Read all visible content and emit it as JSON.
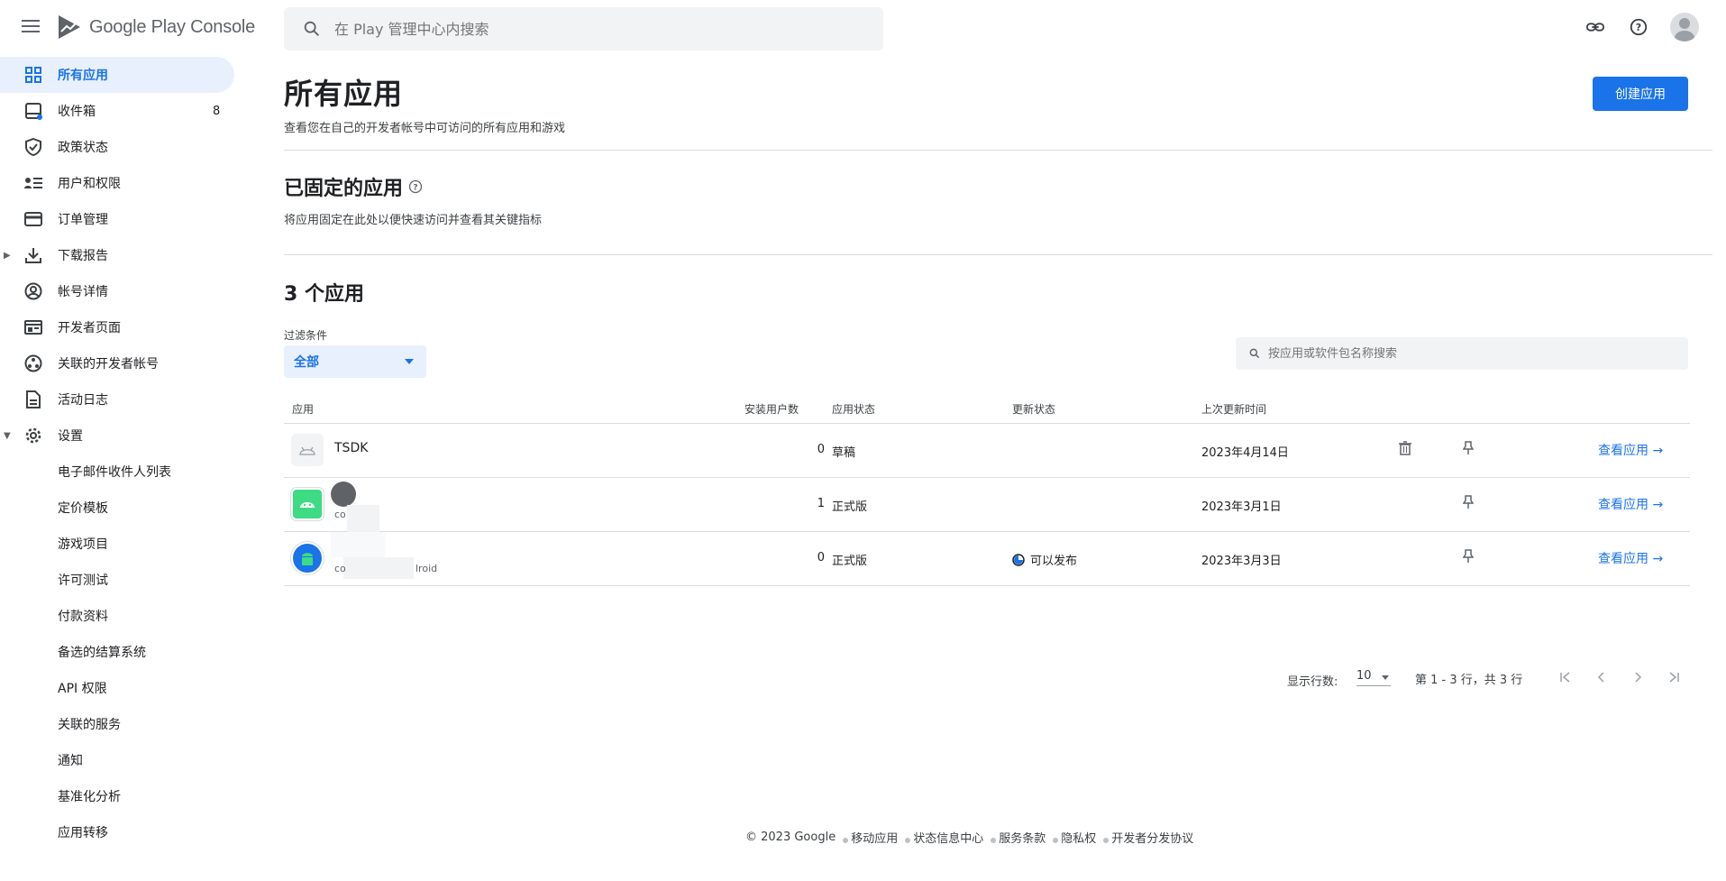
{
  "header": {
    "app_name": "Google Play Console",
    "search_placeholder": "在 Play 管理中心内搜索"
  },
  "sidebar": {
    "items": [
      {
        "label": "所有应用",
        "icon": "grid-icon",
        "active": true
      },
      {
        "label": "收件箱",
        "icon": "inbox-icon",
        "badge": "8"
      },
      {
        "label": "政策状态",
        "icon": "shield-icon"
      },
      {
        "label": "用户和权限",
        "icon": "users-list-icon"
      },
      {
        "label": "订单管理",
        "icon": "credit-card-icon"
      },
      {
        "label": "下载报告",
        "icon": "download-icon",
        "expandable": true
      },
      {
        "label": "帐号详情",
        "icon": "account-circle-icon"
      },
      {
        "label": "开发者页面",
        "icon": "web-page-icon"
      },
      {
        "label": "关联的开发者帐号",
        "icon": "linked-accounts-icon"
      },
      {
        "label": "活动日志",
        "icon": "log-icon"
      },
      {
        "label": "设置",
        "icon": "gear-icon",
        "expanded": true
      }
    ],
    "settings_sub": [
      "电子邮件收件人列表",
      "定价模板",
      "游戏项目",
      "许可测试",
      "付款资料",
      "备选的结算系统",
      "API 权限",
      "关联的服务",
      "通知",
      "基准化分析",
      "应用转移"
    ]
  },
  "main": {
    "title": "所有应用",
    "subtitle": "查看您在自己的开发者帐号中可访问的所有应用和游戏",
    "create_button": "创建应用",
    "pinned_title": "已固定的应用",
    "pinned_subtitle": "将应用固定在此处以便快速访问并查看其关键指标",
    "count_title": "3 个应用",
    "filter_label": "过滤条件",
    "filter_value": "全部",
    "table_search_placeholder": "按应用或软件包名称搜索"
  },
  "table": {
    "columns": [
      "应用",
      "安装用户数",
      "应用状态",
      "更新状态",
      "上次更新时间"
    ],
    "rows": [
      {
        "name": "TSDK",
        "pkg": "",
        "installs": "0",
        "status": "草稿",
        "update_status": "",
        "updated": "2023年4月14日",
        "action": "查看应用"
      },
      {
        "name": "",
        "pkg": "co",
        "installs": "1",
        "status": "正式版",
        "update_status": "",
        "updated": "2023年3月1日",
        "action": "查看应用"
      },
      {
        "name": "",
        "pkg": "co",
        "pkg_tail": "lroid",
        "installs": "0",
        "status": "正式版",
        "update_status": "可以发布",
        "updated": "2023年3月3日",
        "action": "查看应用"
      }
    ]
  },
  "pagination": {
    "rows_label": "显示行数:",
    "rows_value": "10",
    "range": "第 1 - 3 行，共 3 行"
  },
  "footer": {
    "copyright": "© 2023 Google",
    "links": [
      "移动应用",
      "状态信息中心",
      "服务条款",
      "隐私权",
      "开发者分发协议"
    ]
  },
  "colors": {
    "accent": "#1a73e8",
    "active_bg": "#e8f0fe",
    "divider": "#dadce0"
  }
}
